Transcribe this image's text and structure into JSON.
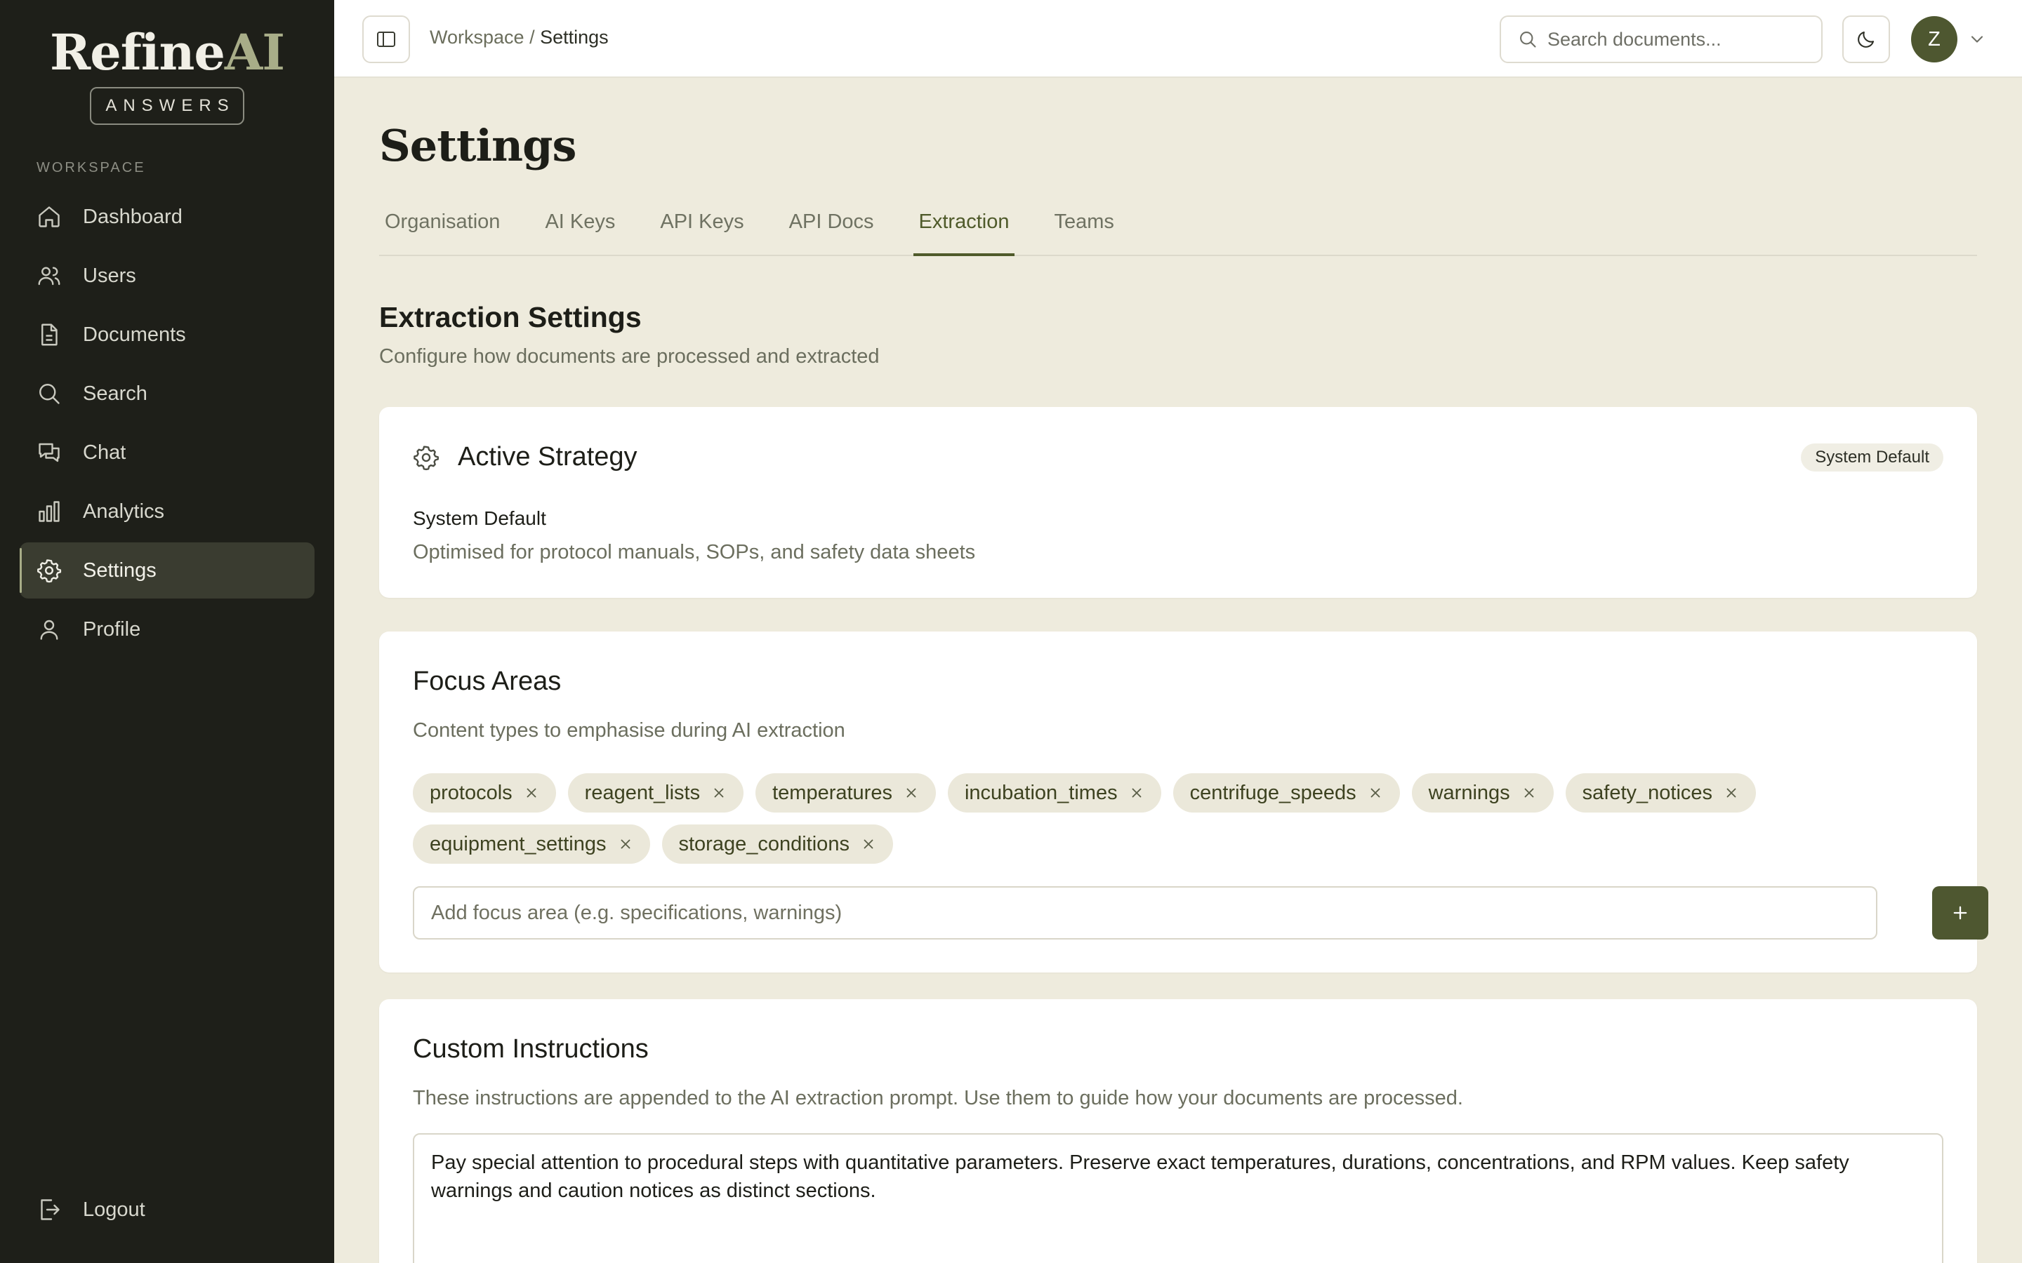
{
  "brand": {
    "name_main": "Refine",
    "name_accent": "AI",
    "badge": "ANSWERS",
    "accent_color": "#a8ad88"
  },
  "sidebar": {
    "section_label": "WORKSPACE",
    "items": [
      {
        "label": "Dashboard",
        "icon": "home-icon"
      },
      {
        "label": "Users",
        "icon": "users-icon"
      },
      {
        "label": "Documents",
        "icon": "document-icon"
      },
      {
        "label": "Search",
        "icon": "search-icon"
      },
      {
        "label": "Chat",
        "icon": "chat-icon"
      },
      {
        "label": "Analytics",
        "icon": "bar-chart-icon"
      },
      {
        "label": "Settings",
        "icon": "gear-icon",
        "active": true
      },
      {
        "label": "Profile",
        "icon": "user-icon"
      }
    ],
    "logout_label": "Logout"
  },
  "topbar": {
    "breadcrumb_parent": "Workspace",
    "breadcrumb_sep": "/",
    "breadcrumb_current": "Settings",
    "search_placeholder": "Search documents...",
    "avatar_initial": "Z",
    "avatar_color": "#4e5730"
  },
  "page": {
    "title": "Settings",
    "tabs": [
      {
        "label": "Organisation"
      },
      {
        "label": "AI Keys"
      },
      {
        "label": "API Keys"
      },
      {
        "label": "API Docs"
      },
      {
        "label": "Extraction",
        "active": true
      },
      {
        "label": "Teams"
      }
    ],
    "section_title": "Extraction Settings",
    "section_subtitle": "Configure how documents are processed and extracted"
  },
  "strategy": {
    "title": "Active Strategy",
    "badge": "System Default",
    "name": "System Default",
    "description": "Optimised for protocol manuals, SOPs, and safety data sheets"
  },
  "focus": {
    "title": "Focus Areas",
    "subtitle": "Content types to emphasise during AI extraction",
    "chips": [
      "protocols",
      "reagent_lists",
      "temperatures",
      "incubation_times",
      "centrifuge_speeds",
      "warnings",
      "safety_notices",
      "equipment_settings",
      "storage_conditions"
    ],
    "input_placeholder": "Add focus area (e.g. specifications, warnings)",
    "add_label": "+"
  },
  "instructions": {
    "title": "Custom Instructions",
    "subtitle": "These instructions are appended to the AI extraction prompt. Use them to guide how your documents are processed.",
    "value": "Pay special attention to procedural steps with quantitative parameters. Preserve exact temperatures, durations, concentrations, and RPM values. Keep safety warnings and caution notices as distinct sections."
  }
}
